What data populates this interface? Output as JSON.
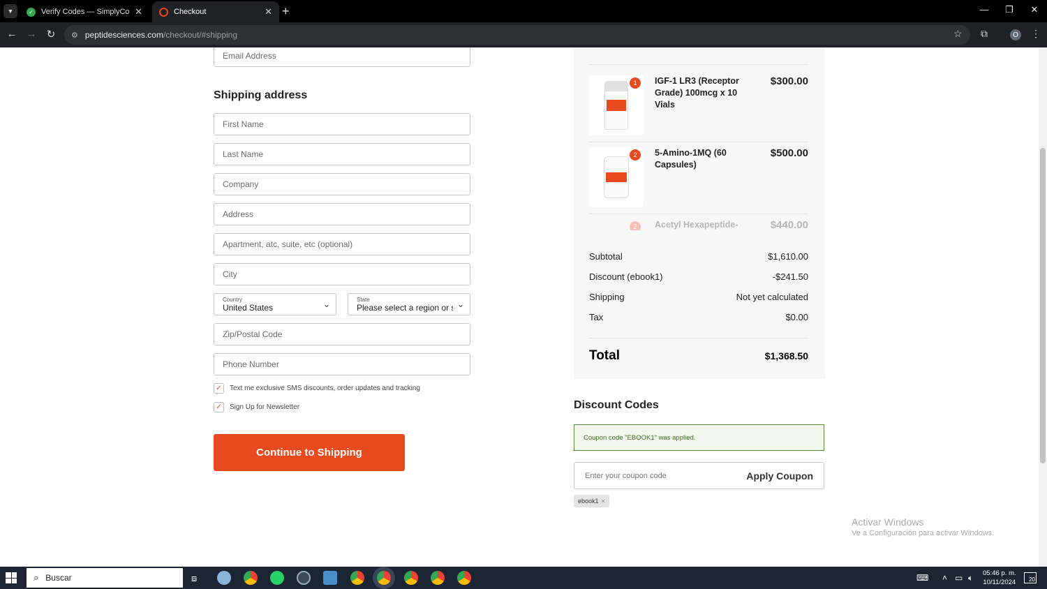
{
  "browser": {
    "tabs": [
      {
        "title": "Verify Codes — SimplyCodes",
        "close": "✕"
      },
      {
        "title": "Checkout",
        "close": "✕"
      }
    ],
    "new_tab": "+",
    "url_host": "peptidesciences.com",
    "url_path": "/checkout/#shipping",
    "window_controls": {
      "minimize": "—",
      "restore": "❐",
      "close": "✕"
    },
    "profile_initial": "O"
  },
  "form": {
    "email_placeholder": "Email Address",
    "shipping_title": "Shipping address",
    "first_name": "First Name",
    "last_name": "Last Name",
    "company": "Company",
    "address": "Address",
    "apartment": "Apartment, atc, suite, etc (optional)",
    "city": "City",
    "country_label": "Country",
    "country_value": "United States",
    "state_label": "State",
    "state_value": "Please select a region or st…",
    "zip": "Zip/Postal Code",
    "phone": "Phone Number",
    "sms_label": "Text me exclusive SMS discounts, order updates and tracking",
    "newsletter_label": "Sign Up for Newsletter",
    "continue_label": "Continue to Shipping"
  },
  "summary": {
    "items": [
      {
        "name": "IGF-1 LR3 (Receptor Grade) 100mcg x 10 Vials",
        "price": "$300.00",
        "qty": "1"
      },
      {
        "name": "5-Amino-1MQ (60 Capsules)",
        "price": "$500.00",
        "qty": "2"
      },
      {
        "name": "Acetyl Hexapeptide-",
        "price": "$440.00",
        "qty": "2"
      }
    ],
    "subtotal_label": "Subtotal",
    "subtotal": "$1,610.00",
    "discount_label": "Discount (ebook1)",
    "discount": "-$241.50",
    "shipping_label": "Shipping",
    "shipping": "Not yet calculated",
    "tax_label": "Tax",
    "tax": "$0.00",
    "total_label": "Total",
    "total": "$1,368.50"
  },
  "discount": {
    "title": "Discount Codes",
    "notice": "Coupon code \"EBOOK1\" was applied.",
    "placeholder": "Enter your coupon code",
    "apply_label": "Apply Coupon",
    "chip": "ebook1",
    "chip_remove": "×"
  },
  "watermark": {
    "line1": "Activar Windows",
    "line2": "Ve a Configuración para activar Windows."
  },
  "taskbar": {
    "search_placeholder": "Buscar",
    "time": "05:46 p. m.",
    "date": "10/11/2024",
    "notifications": "20"
  }
}
